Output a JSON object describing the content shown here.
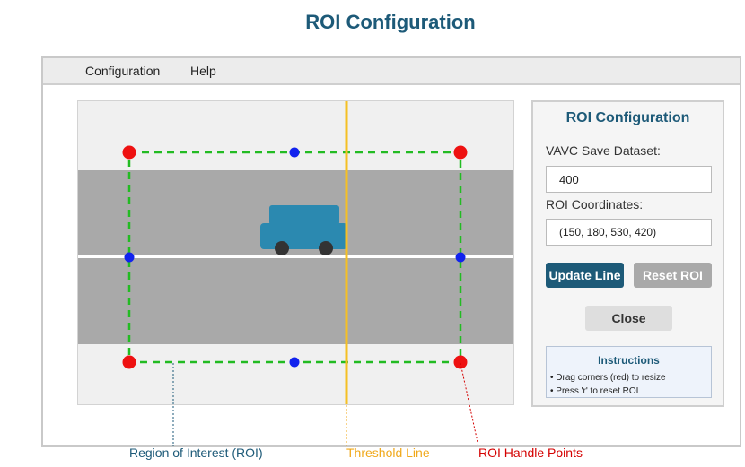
{
  "page_title": "ROI Configuration",
  "menu": {
    "items": [
      {
        "label": "Configuration"
      },
      {
        "label": "Help"
      }
    ]
  },
  "panel": {
    "title": "ROI Configuration",
    "dataset_label": "VAVC Save Dataset:",
    "dataset_value": "400",
    "coords_label": "ROI Coordinates:",
    "coords_value": "(150, 180, 530, 420)",
    "update_button": "Update Line",
    "reset_button": "Reset ROI",
    "close_button": "Close",
    "instructions": {
      "title": "Instructions",
      "lines": [
        "• Drag corners (red) to resize",
        "• Press 'r' to reset ROI"
      ]
    }
  },
  "callouts": {
    "roi": "Region of Interest (ROI)",
    "threshold": "Threshold Line",
    "handles": "ROI Handle Points"
  },
  "colors": {
    "accent": "#1d5a78",
    "roi_border": "#22bb22",
    "threshold": "#f5c024",
    "corner_handle": "#ee1111",
    "edge_handle": "#1122ee",
    "road": "#a9a9a9",
    "vehicle": "#2b89b0",
    "roi_callout": "#1d5a78",
    "threshold_callout": "#f0a81a",
    "handles_callout": "#d40000"
  },
  "icons": {
    "vehicle": "car-icon"
  }
}
